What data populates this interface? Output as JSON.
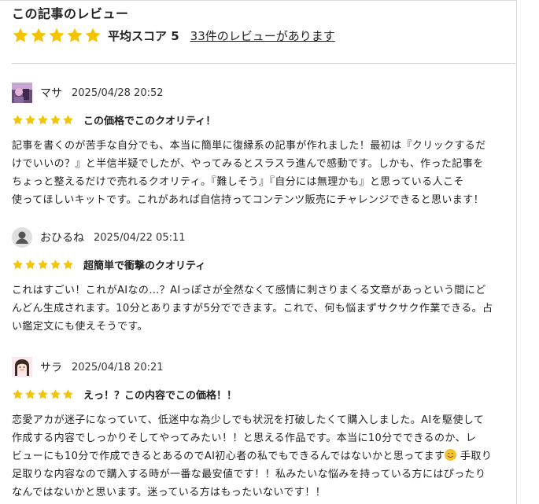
{
  "header": {
    "title": "この記事のレビュー",
    "rating_value": 5,
    "average_label": "平均スコア 5",
    "review_count_link": "33件のレビューがあります"
  },
  "colors": {
    "star": "#f5c400",
    "divider": "#d0d0d0"
  },
  "reviews": [
    {
      "name": "マサ",
      "date": "2025/04/28 20:52",
      "rating": 5,
      "title": "この価格でこのクオリティ！",
      "body": "記事を書くのが苦手な自分でも、本当に簡単に復縁系の記事が作れました！最初は『クリックするだ\nけでいいの？』と半信半疑でしたが、やってみるとスラスラ進んで感動です。しかも、作った記事を\nちょっと整えるだけで売れるクオリティ。『難しそう』『自分には無理かも』と思っている人こそ\n使ってほしいキットです。これがあれば自信持ってコンテンツ販売にチャレンジできると思います！",
      "avatar_icon": "photo-avatar-icon"
    },
    {
      "name": "おひるね",
      "date": "2025/04/22 05:11",
      "rating": 5,
      "title": "超簡単で衝撃のクオリティ",
      "body": "これはすごい！これがAIなの…？AIっぽさが全然なくて感情に刺さりまくる文章があっという間にど\nんどん生成されます。10分とありますが5分でできます。これで、何も悩まずサクサク作業できる。占\nい鑑定文にも使えそうです。",
      "avatar_icon": "default-user-icon"
    },
    {
      "name": "サラ",
      "date": "2025/04/18 20:21",
      "rating": 5,
      "title": "えっ！？この内容でこの価格！！",
      "body_before_emoji": "恋愛アカが迷子になっていて、低迷中な為少しでも状況を打破したくて購入しました。AIを駆使して\n作成する内容でしっかりそしてやってみたい！！と思える作品です。本当に10分でできるのか、レ\nビューにも10分で作成できるとあるのでAI初心者の私でもできるんではないかと思ってます",
      "body_after_emoji": " 手取り\n足取りな内容なので購入する時が一番な最安値です！！私みたいな悩みを持っている方にはぴったり\nなんではないかと思います。迷っている方はもったいないです！！",
      "emoji_icon": "smiling-face-emoji-icon",
      "avatar_icon": "illustrated-girl-avatar-icon"
    }
  ]
}
